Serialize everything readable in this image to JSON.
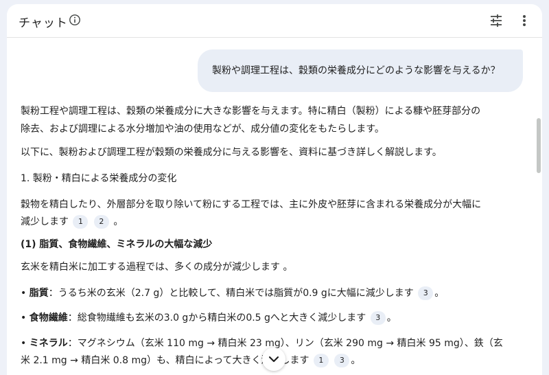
{
  "header": {
    "title": "チャット",
    "icons": [
      "info-icon",
      "tune-icon",
      "more-vert-icon"
    ]
  },
  "user_message": "製粉や調理工程は、穀類の栄養成分にどのような影響を与えるか？",
  "response": {
    "p1_line1": "製粉工程や調理工程は、穀類の栄養成分に大きな影響を与えます。特に精白（製粉）による糠や胚芽部分の",
    "p1_line2": "除去、および調理による水分増加や油の使用などが、成分値の変化をもたらします。",
    "p2": "以下に、製粉および調理工程が穀類の栄養成分に与える影響を、資料に基づき詳しく解説します。",
    "h1": "1. 製粉・精白による栄養成分の変化",
    "p3_line1": "穀物を精白したり、外層部分を取り除いて粉にする工程では、主に外皮や胚芽に含まれる栄養成分が大幅に",
    "p3_line2": "減少します",
    "p3_cites": [
      "1",
      "2"
    ],
    "h2": "(1) 脂質、食物繊維、ミネラルの大幅な減少",
    "p4": "玄米を精白米に加工する過程では、多くの成分が減少します 。",
    "bullet1_label": "脂質",
    "bullet1_text": "：うるち米の玄米（2.7 g）と比較して、精白米では脂質が0.9 gに大幅に減少します",
    "bullet1_cites": [
      "3"
    ],
    "bullet2_label": "食物繊維",
    "bullet2_text": "：総食物繊維も玄米の3.0 gから精白米の0.5 gへと大きく減少します",
    "bullet2_cites": [
      "3"
    ],
    "bullet3_label": "ミネラル",
    "bullet3_line1": "：マグネシウム（玄米 110 mg → 精白米 23 mg）、リン（玄米 290 mg → 精白米 95 mg）、鉄（玄",
    "bullet3_line2": "米 2.1 mg → 精白米 0.8 mg）も、精白によって大きく減少します",
    "bullet3_cites": [
      "1",
      "3"
    ],
    "bullet_mark": "•",
    "period": "。"
  },
  "colors": {
    "background": "#eef1f8",
    "panel": "#ffffff",
    "bubble": "#e9eef6",
    "text": "#1f1f1f",
    "icon": "#444746"
  }
}
